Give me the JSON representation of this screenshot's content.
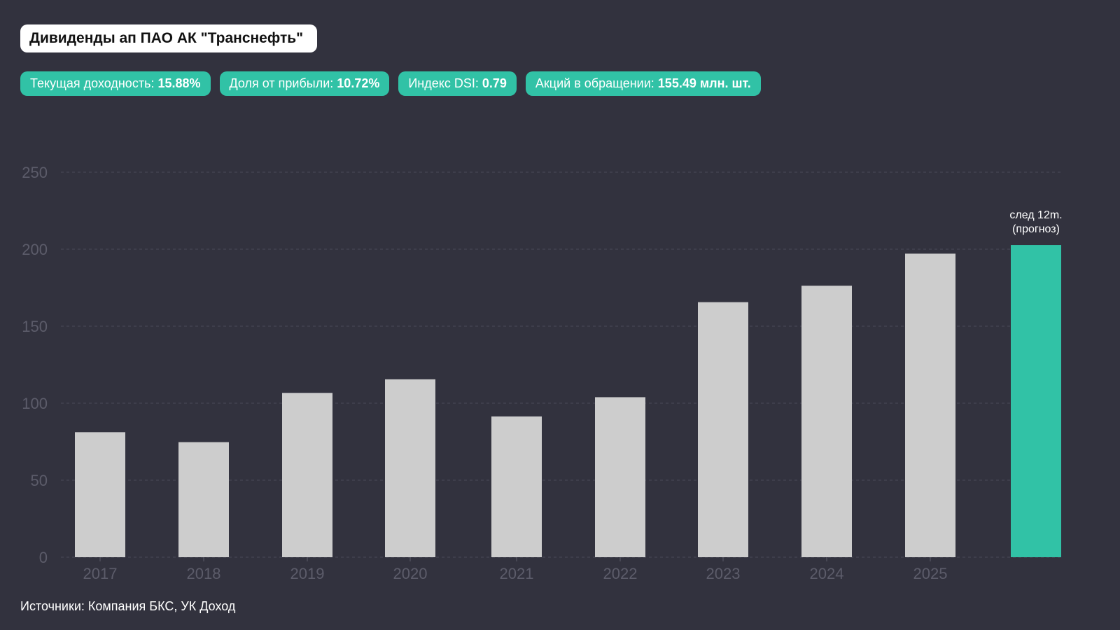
{
  "title": "Дивиденды ап ПАО АК \"Транснефть\"",
  "badges": [
    {
      "label": "Текущая доходность:",
      "value": "15.88%"
    },
    {
      "label": "Доля от прибыли:",
      "value": "10.72%"
    },
    {
      "label": "Индекс DSI:",
      "value": "0.79"
    },
    {
      "label": "Акций в обращении:",
      "value": "155.49 млн. шт."
    }
  ],
  "source": "Источники: Компания БКС, УК Доход",
  "colors": {
    "bar": "#cdcdcd",
    "forecast": "#31c2a6",
    "background": "#32323e",
    "grid": "#4a4a58",
    "tick": "#5c5c6a"
  },
  "chart_data": {
    "type": "bar",
    "title": "Дивиденды ап ПАО АК \"Транснефть\"",
    "xlabel": "",
    "ylabel": "",
    "categories": [
      "2017",
      "2018",
      "2019",
      "2020",
      "2021",
      "2022",
      "2023",
      "2024",
      "2025",
      ""
    ],
    "values": [
      81.2,
      74.7,
      106.7,
      115.5,
      91.4,
      103.9,
      165.6,
      176.3,
      197.1,
      202.7
    ],
    "forecast_index": 9,
    "forecast_label": [
      "след 12m.",
      "(прогноз)"
    ],
    "ylim": [
      0,
      250
    ],
    "yticks": [
      0,
      50,
      100,
      150,
      200,
      250
    ],
    "grid": true
  }
}
